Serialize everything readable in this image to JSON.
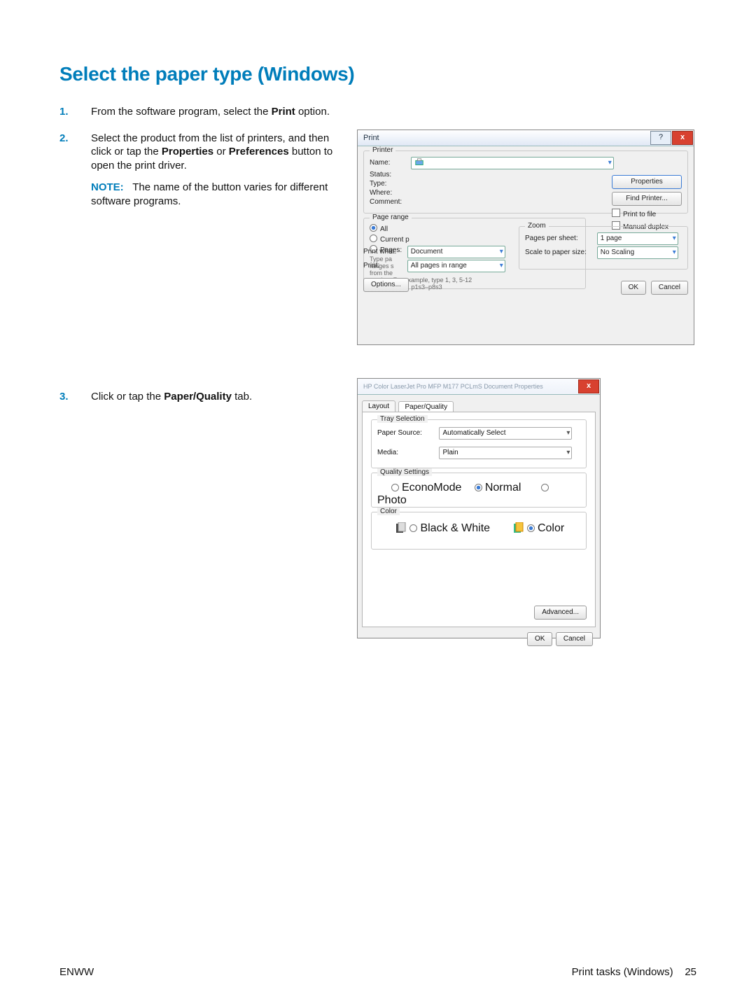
{
  "heading": "Select the paper type (Windows)",
  "steps": {
    "s1": {
      "num": "1.",
      "before": "From the software program, select the ",
      "bold": "Print",
      "after": " option."
    },
    "s2": {
      "num": "2.",
      "before": "Select the product from the list of printers, and then click or tap the ",
      "bold1": "Properties",
      "mid": " or ",
      "bold2": "Preferences",
      "after": " button to open the print driver.",
      "note_label": "NOTE:",
      "note_text": "The name of the button varies for different software programs."
    },
    "s3": {
      "num": "3.",
      "before": "Click or tap the ",
      "bold": "Paper/Quality",
      "after": " tab."
    }
  },
  "dlg1": {
    "title": "Print",
    "printer_group": "Printer",
    "labels": {
      "name": "Name:",
      "status": "Status:",
      "type": "Type:",
      "where": "Where:",
      "comment": "Comment:"
    },
    "right": {
      "properties": "Properties",
      "find": "Find Printer...",
      "print_to_file": "Print to file",
      "manual_duplex": "Manual duplex"
    },
    "range_group": "Page range",
    "range": {
      "all": "All",
      "current": "Current p",
      "pages": "Pages:",
      "hint1": "Type pa",
      "hint2": "ranges s",
      "hint3": "from the",
      "hint4": "section. For example, type 1, 3, 5-12",
      "hint5": "or p1s1, p1s2, p1s3–p8s3"
    },
    "print_what": "Print what:",
    "print_what_val": "Document",
    "print_lbl": "Print:",
    "print_val": "All pages in range",
    "zoom_group": "Zoom",
    "zoom": {
      "pps": "Pages per sheet:",
      "pps_val": "1 page",
      "scale": "Scale to paper size:",
      "scale_val": "No Scaling"
    },
    "options": "Options...",
    "ok": "OK",
    "cancel": "Cancel"
  },
  "dlg2": {
    "title": "HP Color LaserJet Pro MFP M177 PCLmS Document Properties",
    "tabs": {
      "layout": "Layout",
      "pq": "Paper/Quality"
    },
    "tray_group": "Tray Selection",
    "paper_source_lbl": "Paper Source:",
    "paper_source_val": "Automatically Select",
    "media_lbl": "Media:",
    "media_val": "Plain",
    "quality_group": "Quality Settings",
    "quality": {
      "econo": "EconoMode",
      "normal": "Normal",
      "photo": "Photo"
    },
    "color_group": "Color",
    "color": {
      "bw": "Black & White",
      "color": "Color"
    },
    "advanced": "Advanced...",
    "ok": "OK",
    "cancel": "Cancel"
  },
  "footer": {
    "left": "ENWW",
    "right_text": "Print tasks (Windows)",
    "page": "25"
  }
}
